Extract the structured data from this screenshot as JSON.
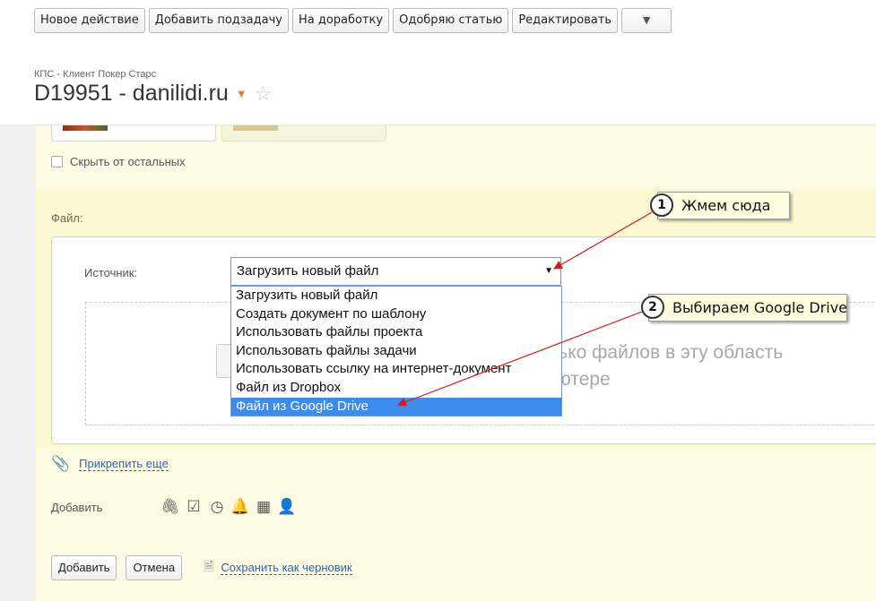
{
  "toolbar": {
    "buttons": [
      "Новое действие",
      "Добавить подзадачу",
      "На доработку",
      "Одобряю статью",
      "Редактировать"
    ],
    "more_icon": "▼"
  },
  "header": {
    "breadcrumb": "КПС - Клиент Покер Старс",
    "title": "D19951 - danilidi.ru",
    "accent_color": "#f07b26"
  },
  "form": {
    "hide_label": "Скрыть от остальных",
    "file_label": "Файл:",
    "source_label": "Источник:",
    "source_selected": "Загрузить новый файл",
    "source_options": [
      "Загрузить новый файл",
      "Создать документ по шаблону",
      "Использовать файлы проекта",
      "Использовать файлы задачи",
      "Использовать ссылку на интернет-документ",
      "Файл из Dropbox",
      "Файл из Google Drive"
    ],
    "highlighted_option": "Файл из Google Drive",
    "drop_text_line1": "лько файлов в эту область",
    "drop_text_line2": "ьютере",
    "attach_more": "Прикрепить еще",
    "add_label": "Добавить",
    "add_icons": [
      "paperclip-icon",
      "checkbox-icon",
      "clock-icon",
      "bell-icon",
      "calendar-icon",
      "user-add-icon"
    ],
    "submit_label": "Добавить",
    "cancel_label": "Отмена",
    "draft_label": "Сохранить как черновик"
  },
  "annotations": {
    "step1_num": "1",
    "step1_text": "Жмем сюда",
    "step2_num": "2",
    "step2_text": "Выбираем Google Drive",
    "arrow_color": "#d11a1a"
  }
}
